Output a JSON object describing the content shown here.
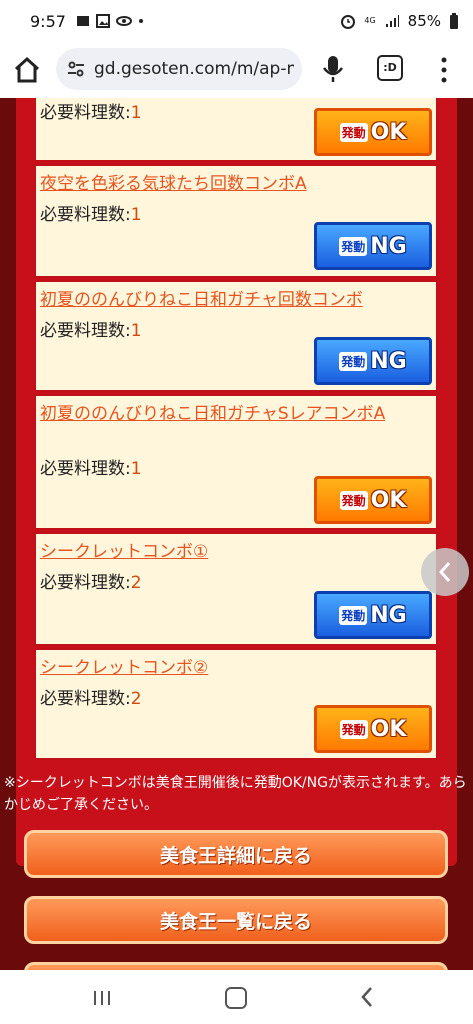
{
  "status_bar": {
    "time": "9:57",
    "network": "4G",
    "battery": "85%"
  },
  "browser": {
    "url": "gd.gesoten.com/m/ap-m",
    "tab_label": ":D"
  },
  "combos": [
    {
      "title": "",
      "req_label": "必要料理数:",
      "req_value": "1",
      "status": "OK",
      "tag": "発動"
    },
    {
      "title": "夜空を色彩る気球たち回数コンボA",
      "req_label": "必要料理数:",
      "req_value": "1",
      "status": "NG",
      "tag": "発動"
    },
    {
      "title": "初夏ののんびりねこ日和ガチャ回数コンボ",
      "req_label": "必要料理数:",
      "req_value": "1",
      "status": "NG",
      "tag": "発動"
    },
    {
      "title": "初夏ののんびりねこ日和ガチャSレアコンボA",
      "req_label": "必要料理数:",
      "req_value": "1",
      "status": "OK",
      "tag": "発動"
    },
    {
      "title": "シークレットコンボ①",
      "req_label": "必要料理数:",
      "req_value": "2",
      "status": "NG",
      "tag": "発動"
    },
    {
      "title": "シークレットコンボ②",
      "req_label": "必要料理数:",
      "req_value": "2",
      "status": "OK",
      "tag": "発動"
    }
  ],
  "note": "※シークレットコンボは美食王開催後に発動OK/NGが表示されます。あらかじめご了承ください。",
  "buttons": {
    "back_detail": "美食王詳細に戻る",
    "back_list": "美食王一覧に戻る"
  }
}
